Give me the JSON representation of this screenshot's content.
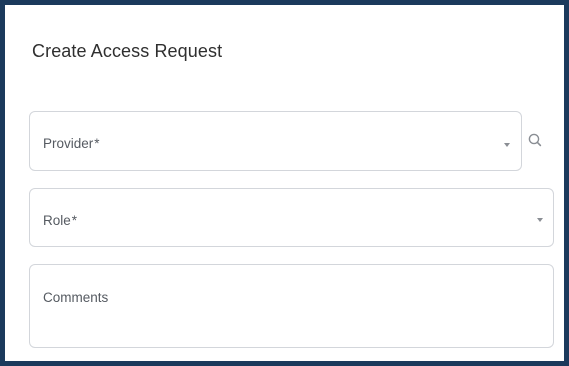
{
  "form": {
    "title": "Create Access Request",
    "fields": {
      "provider": {
        "label": "Provider",
        "required_marker": "*",
        "value": ""
      },
      "role": {
        "label": "Role",
        "required_marker": "*",
        "value": ""
      },
      "comments": {
        "label": "Comments",
        "value": ""
      }
    }
  },
  "icons": {
    "provider_dropdown": "chevron-down-icon",
    "role_dropdown": "chevron-down-icon",
    "provider_search": "search-icon"
  },
  "colors": {
    "frame_border": "#1b3a5c",
    "field_border": "#d3d6db",
    "label_text": "#555a61",
    "title_text": "#2f2f2f"
  }
}
